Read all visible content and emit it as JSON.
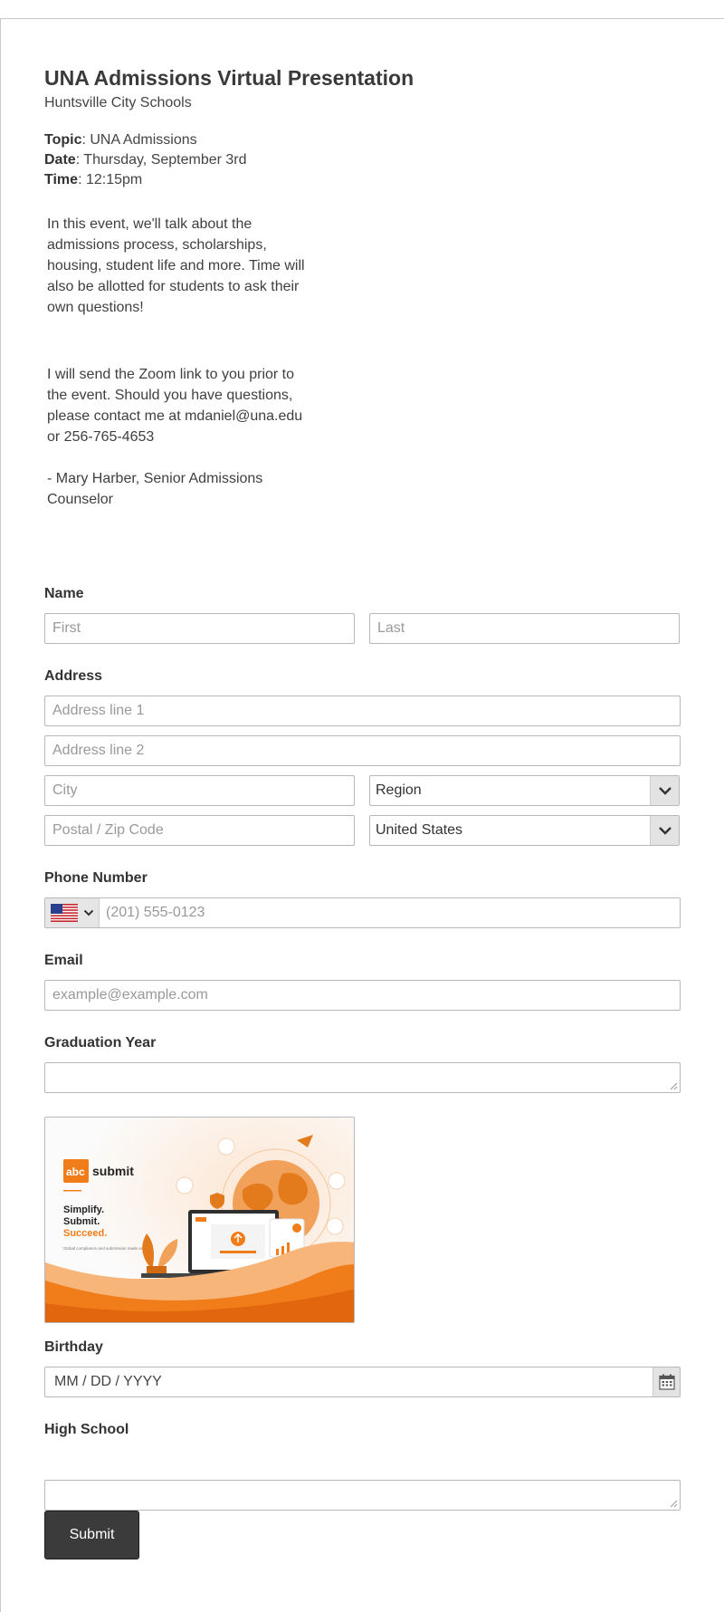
{
  "header": {
    "title": "UNA Admissions Virtual Presentation",
    "subtitle": "Huntsville City Schools"
  },
  "details": {
    "topic_label": "Topic",
    "topic_value": ": UNA Admissions",
    "date_label": "Date",
    "date_value": ": Thursday, September 3rd",
    "time_label": "Time",
    "time_value": ": 12:15pm"
  },
  "description": {
    "para1": "In this event, we'll talk about the admissions process, scholarships, housing, student life and more. Time will also be allotted for students to ask their own questions!",
    "para2": "I will send the Zoom link to you prior to the event. Should you have questions, please contact me at mdaniel@una.edu or 256-765-4653",
    "signature": "- Mary Harber, Senior Admissions Counselor"
  },
  "form": {
    "name_label": "Name",
    "first_placeholder": "First",
    "last_placeholder": "Last",
    "address_label": "Address",
    "address1_placeholder": "Address line 1",
    "address2_placeholder": "Address line 2",
    "city_placeholder": "City",
    "region_value": "Region",
    "zip_placeholder": "Postal / Zip Code",
    "country_value": "United States",
    "phone_label": "Phone Number",
    "phone_placeholder": "(201) 555-0123",
    "email_label": "Email",
    "email_placeholder": "example@example.com",
    "grad_label": "Graduation Year",
    "birthday_label": "Birthday",
    "birthday_placeholder": "MM / DD / YYYY",
    "school_label": "High School",
    "submit_label": "Submit"
  },
  "promo": {
    "brand_box": "abc",
    "brand_text": "submit",
    "line1": "Simplify.",
    "line2": "Submit.",
    "line3": "Succeed.",
    "tagline": "Global compliance and submission made easy.",
    "accent": "#f07d1a"
  },
  "icons": {
    "flag": "us-flag-icon",
    "chevron": "chevron-down-icon",
    "calendar": "calendar-icon"
  }
}
